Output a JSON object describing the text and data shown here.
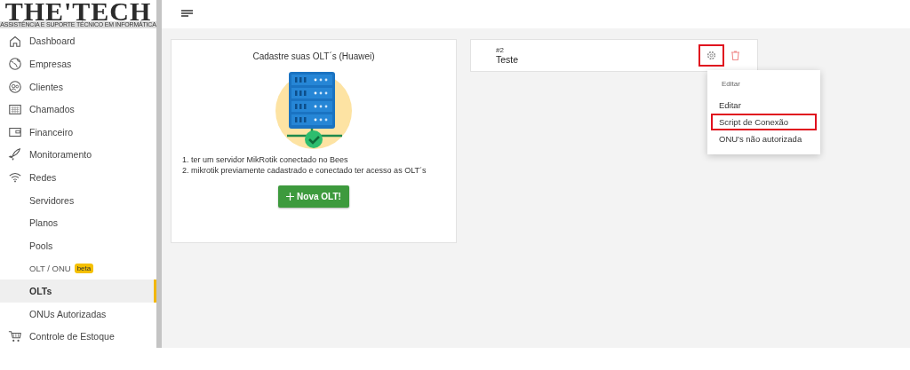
{
  "logo": {
    "name": "THE'TECH",
    "tagline": "ASSISTÊNCIA E SUPORTE TÉCNICO EM INFORMÁTICA"
  },
  "sidebar": {
    "items": [
      {
        "label": "Dashboard",
        "kind": "icon",
        "selected": false
      },
      {
        "label": "Empresas",
        "kind": "icon",
        "selected": false
      },
      {
        "label": "Clientes",
        "kind": "icon",
        "selected": false
      },
      {
        "label": "Chamados",
        "kind": "icon",
        "selected": false
      },
      {
        "label": "Financeiro",
        "kind": "icon",
        "selected": false
      },
      {
        "label": "Monitoramento",
        "kind": "icon",
        "selected": false
      },
      {
        "label": "Redes",
        "kind": "icon",
        "selected": false
      },
      {
        "label": "Servidores",
        "kind": "sub",
        "selected": false
      },
      {
        "label": "Planos",
        "kind": "sub",
        "selected": false
      },
      {
        "label": "Pools",
        "kind": "sub",
        "selected": false
      },
      {
        "label": "OLT / ONU",
        "kind": "section",
        "badge": "beta",
        "selected": false
      },
      {
        "label": "OLTs",
        "kind": "sub",
        "selected": true
      },
      {
        "label": "ONUs Autorizadas",
        "kind": "sub",
        "selected": false
      },
      {
        "label": "Controle de Estoque",
        "kind": "icon",
        "selected": false
      }
    ]
  },
  "intro_card": {
    "title": "Cadastre suas OLT´s (Huawei)",
    "steps": [
      "1. ter um servidor MikRotik conectado no Bees",
      "2. mikrotik previamente cadastrado e conectado ter acesso as OLT´s"
    ],
    "button": "Nova OLT!"
  },
  "olt_card": {
    "number": "#2",
    "name": "Teste",
    "settings_highlighted": true
  },
  "menu": {
    "header": "Editar",
    "items": [
      {
        "label": "Editar",
        "highlighted": false
      },
      {
        "label": "Script de Conexão",
        "highlighted": true
      },
      {
        "label": "ONU's não autorizada",
        "highlighted": false
      }
    ]
  }
}
